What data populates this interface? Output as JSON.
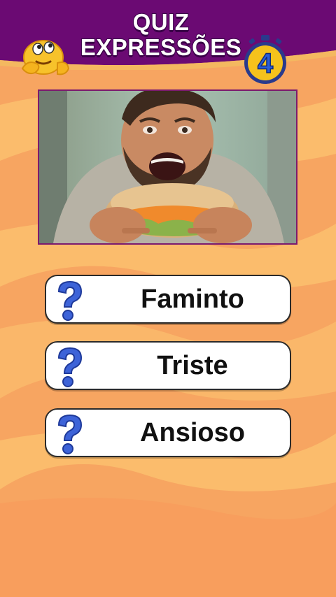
{
  "header": {
    "title_line1": "QUIZ",
    "title_line2": "EXPRESSÕES",
    "timer_value": "4",
    "emoji_icon": "thinking-face-emoji",
    "timer_icon": "stopwatch-icon"
  },
  "question": {
    "image_description_icon": "man-eating-sandwich-photo"
  },
  "options": [
    {
      "label": "Faminto",
      "icon": "question-mark-icon"
    },
    {
      "label": "Triste",
      "icon": "question-mark-icon"
    },
    {
      "label": "Ansioso",
      "icon": "question-mark-icon"
    }
  ],
  "colors": {
    "header": "#6b0a73",
    "background": "#f7a561",
    "wave_light": "#fbbf6e",
    "question_mark": "#3d63d8",
    "timer": "#f6c21c"
  }
}
